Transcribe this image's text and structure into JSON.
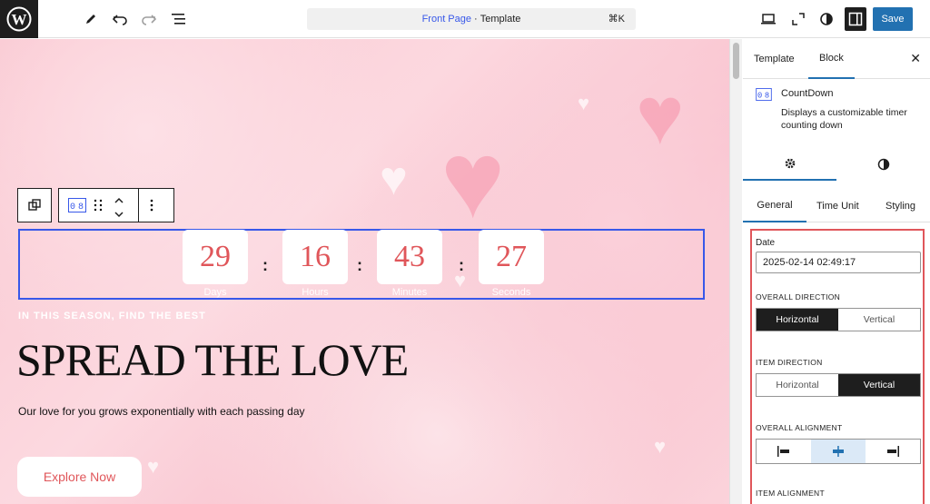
{
  "toolbar": {
    "command_page": "Front Page",
    "command_sep": " · ",
    "command_type": "Template",
    "command_shortcut": "⌘K",
    "save_label": "Save"
  },
  "countdown": {
    "items": [
      {
        "value": "29",
        "label": "Days"
      },
      {
        "value": "16",
        "label": "Hours"
      },
      {
        "value": "43",
        "label": "Minutes"
      },
      {
        "value": "27",
        "label": "Seconds"
      }
    ],
    "separator": ":"
  },
  "hero": {
    "kicker": "IN THIS SEASON, FIND THE BEST",
    "title": "SPREAD THE LOVE",
    "subtitle": "Our love for you grows exponentially with each passing day",
    "button": "Explore Now"
  },
  "sidebar": {
    "tabs": [
      "Template",
      "Block"
    ],
    "block_name": "CountDown",
    "block_desc": "Displays a customizable timer counting down",
    "sub_tabs": [
      "General",
      "Time Unit",
      "Styling"
    ],
    "date_label": "Date",
    "date_value": "2025-02-14 02:49:17",
    "overall_direction_label": "OVERALL DIRECTION",
    "overall_direction_options": [
      "Horizontal",
      "Vertical"
    ],
    "item_direction_label": "ITEM DIRECTION",
    "item_direction_options": [
      "Horizontal",
      "Vertical"
    ],
    "overall_alignment_label": "OVERALL ALIGNMENT",
    "item_alignment_label": "ITEM ALIGNMENT"
  },
  "colors": {
    "accent": "#2271b1",
    "countdown_digits": "#e0565a",
    "highlight_border": "#e0565a"
  }
}
